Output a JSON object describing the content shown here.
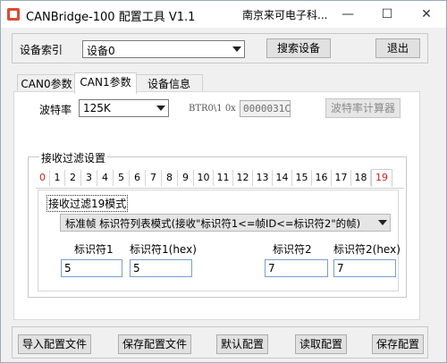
{
  "window": {
    "title": "CANBridge-100 配置工具 V1.1",
    "company": "南京来可电子科...",
    "minimize": "—",
    "maximize": "☐",
    "close": "✕"
  },
  "device": {
    "index_label": "设备索引",
    "index_value": "设备0",
    "search_button": "搜索设备",
    "exit_button": "退出"
  },
  "tabs": [
    {
      "label": "CAN0参数"
    },
    {
      "label": "CAN1参数"
    },
    {
      "label": "设备信息"
    }
  ],
  "baud": {
    "label": "波特率",
    "value": "125K",
    "btr_label": "BTR0\\1 0x",
    "btr_value": "0000031C",
    "calc_button": "波特率计算器"
  },
  "filter": {
    "group_title": "接收过滤设置",
    "tabs": [
      "0",
      "1",
      "2",
      "3",
      "4",
      "5",
      "6",
      "7",
      "8",
      "9",
      "10",
      "11",
      "12",
      "13",
      "14",
      "15",
      "16",
      "17",
      "18",
      "19"
    ],
    "mode_label": "接收过滤19模式",
    "mode_value": "标准帧 标识符列表模式(接收\"标识符1<=帧ID<=标识符2\"的帧)",
    "id1_label": "标识符1",
    "id1_hex_label": "标识符1(hex)",
    "id2_label": "标识符2",
    "id2_hex_label": "标识符2(hex)",
    "id1_value": "5",
    "id1_hex_value": "5",
    "id2_value": "7",
    "id2_hex_value": "7"
  },
  "footer": {
    "import_button": "导入配置文件",
    "save_file_button": "保存配置文件",
    "default_button": "默认配置",
    "read_button": "读取配置",
    "save_button": "保存配置"
  },
  "colors": {
    "accent_red": "#d02020",
    "border_blue": "#7a9cd3"
  }
}
